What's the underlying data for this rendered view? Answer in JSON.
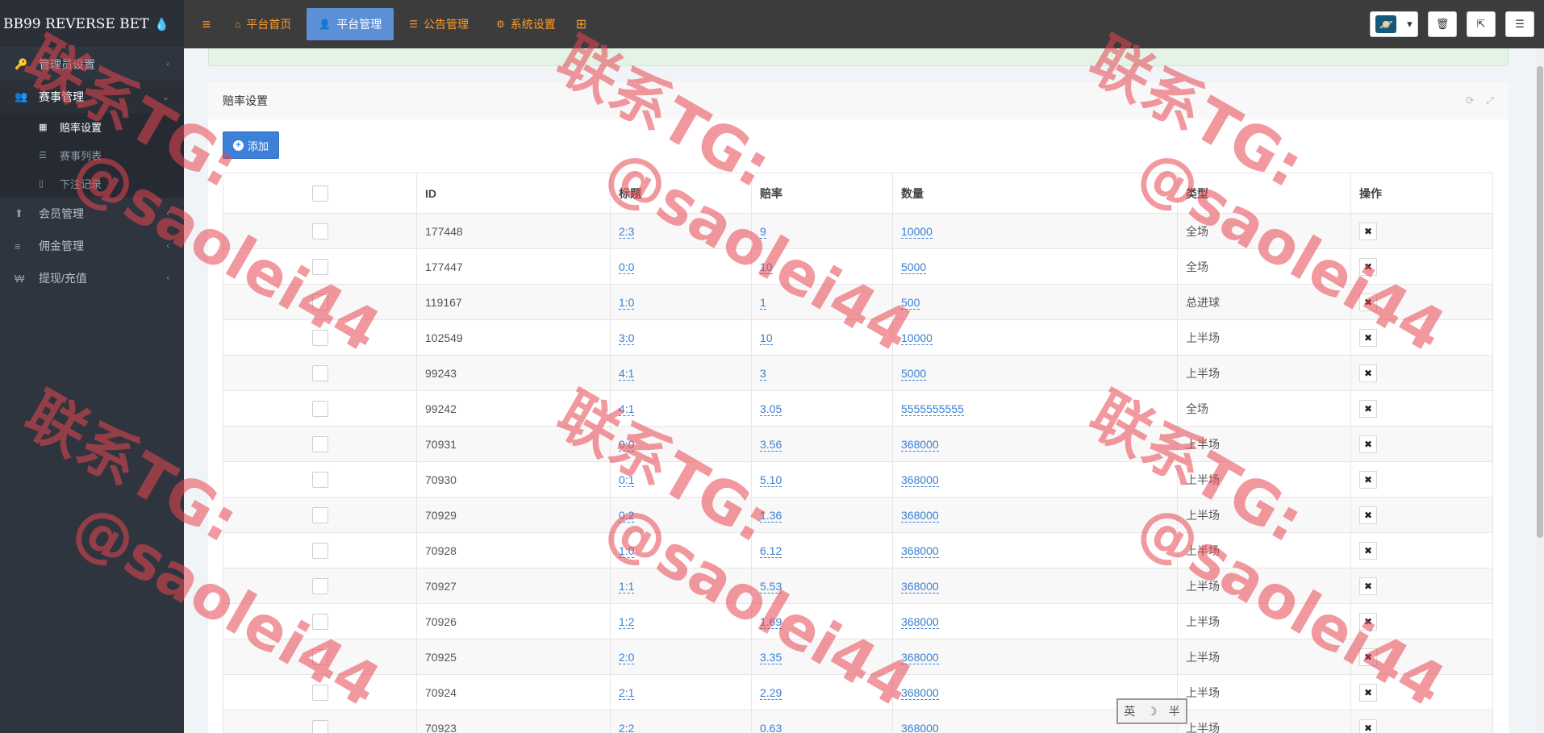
{
  "brand": {
    "logo_text": "BB99 REVERSE BET",
    "toggle_icon": "drop-icon"
  },
  "sidebar": {
    "items": [
      {
        "label": "管理员设置",
        "icon": "key-icon",
        "active": false
      },
      {
        "label": "赛事管理",
        "icon": "users-icon",
        "active": true
      },
      {
        "label": "会员管理",
        "icon": "up-arrow-icon",
        "active": false
      },
      {
        "label": "佣金管理",
        "icon": "database-icon",
        "active": false
      },
      {
        "label": "提现/充值",
        "icon": "won-icon",
        "active": false
      }
    ],
    "subitems": [
      {
        "label": "赔率设置",
        "icon": "grid-icon",
        "active": true
      },
      {
        "label": "赛事列表",
        "icon": "list-icon",
        "active": false
      },
      {
        "label": "下注记录",
        "icon": "file-icon",
        "active": false
      }
    ]
  },
  "topnav": {
    "items": [
      {
        "label": "平台首页",
        "icon": "home-icon",
        "active": false
      },
      {
        "label": "平台管理",
        "icon": "user-icon",
        "active": true
      },
      {
        "label": "公告管理",
        "icon": "list-icon",
        "active": false
      },
      {
        "label": "系统设置",
        "icon": "gear-icon",
        "active": false
      }
    ]
  },
  "panel": {
    "title": "赔率设置",
    "add_label": "添加"
  },
  "table": {
    "headers": [
      "",
      "ID",
      "标题",
      "赔率",
      "数量",
      "类型",
      "操作"
    ],
    "rows": [
      {
        "id": "177448",
        "title": "2:3",
        "odds": "9",
        "qty": "10000",
        "type": "全场"
      },
      {
        "id": "177447",
        "title": "0:0",
        "odds": "10",
        "qty": "5000",
        "type": "全场"
      },
      {
        "id": "119167",
        "title": "1:0",
        "odds": "1",
        "qty": "500",
        "type": "总进球"
      },
      {
        "id": "102549",
        "title": "3:0",
        "odds": "10",
        "qty": "10000",
        "type": "上半场"
      },
      {
        "id": "99243",
        "title": "4:1",
        "odds": "3",
        "qty": "5000",
        "type": "上半场"
      },
      {
        "id": "99242",
        "title": "4:1",
        "odds": "3.05",
        "qty": "5555555555",
        "type": "全场"
      },
      {
        "id": "70931",
        "title": "0:0",
        "odds": "3.56",
        "qty": "368000",
        "type": "上半场"
      },
      {
        "id": "70930",
        "title": "0:1",
        "odds": "5.10",
        "qty": "368000",
        "type": "上半场"
      },
      {
        "id": "70929",
        "title": "0:2",
        "odds": "1.36",
        "qty": "368000",
        "type": "上半场"
      },
      {
        "id": "70928",
        "title": "1:0",
        "odds": "6.12",
        "qty": "368000",
        "type": "上半场"
      },
      {
        "id": "70927",
        "title": "1:1",
        "odds": "5.53",
        "qty": "368000",
        "type": "上半场"
      },
      {
        "id": "70926",
        "title": "1:2",
        "odds": "1.69",
        "qty": "368000",
        "type": "上半场"
      },
      {
        "id": "70925",
        "title": "2:0",
        "odds": "3.35",
        "qty": "368000",
        "type": "上半场"
      },
      {
        "id": "70924",
        "title": "2:1",
        "odds": "2.29",
        "qty": "368000",
        "type": "上半场"
      },
      {
        "id": "70923",
        "title": "2:2",
        "odds": "0.63",
        "qty": "368000",
        "type": "上半场"
      }
    ]
  },
  "watermark": {
    "line1": "联系TG:",
    "line2": "@saolei44"
  },
  "ime": {
    "lang": "英",
    "moon": "☽",
    "mode": "半"
  },
  "colors": {
    "accent": "#ff9a2c",
    "primary": "#3c81d7",
    "sidebar": "#2f353f",
    "topbar": "#3c3c3c"
  }
}
